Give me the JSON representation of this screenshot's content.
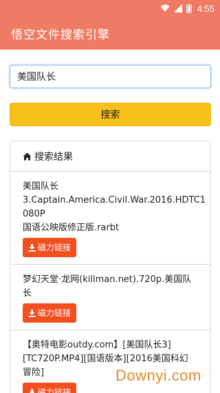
{
  "status_bar": {
    "time": "4:55",
    "icons": [
      "wifi-icon",
      "signal-icon",
      "battery-icon"
    ]
  },
  "app_bar": {
    "title": "悟空文件搜索引擎"
  },
  "search": {
    "value": "美国队长",
    "button_label": "搜索"
  },
  "results_panel": {
    "header_icon": "home-icon",
    "header_label": "搜索结果",
    "items": [
      {
        "title_lines": [
          "美国队长",
          "3.Captain.America.Civil.War.2016.HDTC1080P",
          "国语公映版修正版.rarbt"
        ],
        "button_label": "磁力链接"
      },
      {
        "title_lines": [
          "梦幻天堂·龙网(killman.net).720p.美国队",
          "长"
        ],
        "button_label": "磁力链接"
      },
      {
        "title_lines": [
          "【奥特电影outdy.com】[美国队长3]",
          "[TC720P.MP4][国语版本][2016美国科幻",
          "冒险]"
        ],
        "button_label": "磁力链接"
      }
    ]
  },
  "watermark": "Downyi.com",
  "colors": {
    "app_bar": "#f07b65",
    "search_button": "#f8c01a",
    "magnet_button": "#f24e1e",
    "watermark": "#e8892c"
  }
}
